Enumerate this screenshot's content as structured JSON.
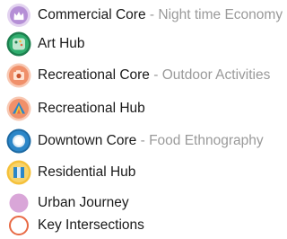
{
  "legend": {
    "items": [
      {
        "icon": "crown-icon",
        "color": "#b58fd6",
        "label": "Commercial Core",
        "separator": " - ",
        "sublabel": "Night time Economy"
      },
      {
        "icon": "palette-icon",
        "color": "#2fae6e",
        "label": "Art Hub"
      },
      {
        "icon": "camera-icon",
        "color": "#f0906a",
        "label": "Recreational Core",
        "separator": " - ",
        "sublabel": "Outdoor Activities"
      },
      {
        "icon": "tent-icon",
        "color": "#f0906a",
        "label": "Recreational Hub"
      },
      {
        "icon": "ring-icon",
        "color": "#2b86c8",
        "label": "Downtown Core",
        "separator": " - ",
        "sublabel": "Food Ethnography"
      },
      {
        "icon": "building-icon",
        "color": "#f5c13b",
        "label": "Residential Hub"
      },
      {
        "icon": "dot-icon",
        "color": "#d9a6d8",
        "label": "Urban Journey"
      },
      {
        "icon": "circle-outline-icon",
        "color": "#e86a45",
        "label": "Key Intersections"
      }
    ]
  }
}
